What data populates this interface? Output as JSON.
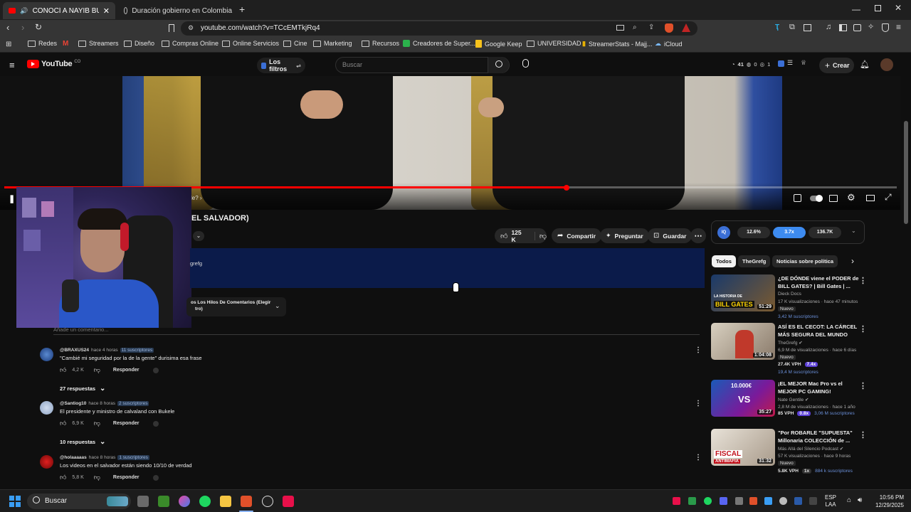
{
  "browser": {
    "tabs": [
      {
        "title": "CONOCÍ A NAYIB BUKELE (P",
        "active": true
      },
      {
        "title": "Duración gobierno en Colombia",
        "active": false
      }
    ],
    "new_tab": "+",
    "url": "youtube.com/watch?v=TCcEMTkjRq4",
    "bookmarks": [
      "Redes",
      "Streamers",
      "Diseño",
      "Compras Online",
      "Online Servicios",
      "Cine",
      "Marketing",
      "Recursos",
      "Creadores de Super...",
      "Google Keep",
      "UNIVERSIDAD",
      "StreamerStats - Majj...",
      "iCloud"
    ]
  },
  "youtube": {
    "logo": "YouTube",
    "logo_country": "CO",
    "filter_button": "Los filtros",
    "search_placeholder": "Buscar",
    "header_stats": {
      "a": "41",
      "b": "0",
      "c": "1"
    },
    "create_button": "Crear"
  },
  "video": {
    "progress_fraction": 0.63,
    "title_visible": "EL SALVADOR)",
    "chapter_fragment": "le?",
    "actions": {
      "likes": "125 K",
      "share": "Compartir",
      "ask": "Preguntar",
      "save": "Guardar"
    },
    "metrics": {
      "a": "12.6%",
      "b": "3.7x",
      "c": "136.7K"
    },
    "channel_fragment": "grefg",
    "sort_fragment": "os Los Hilos De Comentarios (Elegir",
    "sort_fragment2": "tro)",
    "add_comment": "Añade un comentario..."
  },
  "comments": [
    {
      "user": "@BRAXUS24",
      "time": "hace 4 horas",
      "subs": "11 suscriptores",
      "text": "\"Cambié mi seguridad por la de la gente\" durisima esa frase",
      "likes": "4,2 K",
      "reply": "Responder",
      "replies": "27 respuestas",
      "avatar_color": "#2a4d8a"
    },
    {
      "user": "@Santiog10",
      "time": "hace 8 horas",
      "subs": "2 suscriptores",
      "text": "El presidente y ministro de calvaland con Bukele",
      "likes": "6,9 K",
      "reply": "Responder",
      "replies": "10 respuestas",
      "avatar_color": "#9fb3cf"
    },
    {
      "user": "@holaaaaas",
      "time": "hace 8 horas",
      "subs": "1 suscriptores",
      "text": "Los videos en el salvador están siendo 10/10 de verdad",
      "likes": "5,8 K",
      "reply": "Responder",
      "replies": "",
      "avatar_color": "#a01010"
    }
  ],
  "sidebar": {
    "chips": [
      "Todos",
      "TheGrefg",
      "Noticias sobre política"
    ],
    "recommendations": [
      {
        "title": "¿DE DÓNDE viene el PODER de BILL GATES? | Bill Gates | ...",
        "channel": "Dieck Docs",
        "meta": "17 K visualizaciones · hace 47 minutos",
        "badge": "Nuevo",
        "duration": "51:29",
        "thumb_text": "BILL GATES",
        "thumb_text2": "LA HISTORIA DE",
        "stats": [
          {
            "text": "3,42 M suscriptores",
            "color": "#6a8fd8"
          }
        ]
      },
      {
        "title": "ASÍ ES EL CECOT: LA CÁRCEL MÁS SEGURA DEL MUNDO",
        "channel": "TheGrefg",
        "meta": "6,9 M de visualizaciones · hace 6 días",
        "badge": "Nuevo",
        "duration": "1:04:08",
        "thumb_text": "",
        "thumb_text2": "",
        "stats": [
          {
            "text": "27.4K VPH",
            "color": "#e0e0e0"
          },
          {
            "text": "7.4x",
            "color": "#ffffff",
            "bg": "#5b3fd6"
          },
          {
            "text": "19,4 M suscriptores",
            "color": "#6a8fd8"
          }
        ]
      },
      {
        "title": "¡EL MEJOR Mac Pro vs el MEJOR PC GAMING!",
        "channel": "Nate Gentile",
        "meta": "2,8 M de visualizaciones · hace 1 año",
        "badge": "",
        "duration": "35:27",
        "thumb_text": "VS",
        "thumb_text2": "10.000€",
        "stats": [
          {
            "text": "85 VPH",
            "color": "#e0e0e0"
          },
          {
            "text": "0.8x",
            "color": "#ffffff",
            "bg": "#5b3fd6"
          },
          {
            "text": "3,06 M suscriptores",
            "color": "#6a8fd8"
          }
        ]
      },
      {
        "title": "\"Por ROBARLE \"SUPUESTA\" Millonaria COLECCIÓN de ...",
        "channel": "Más Allá del Silencio Podcast",
        "meta": "57 K visualizaciones · hace 9 horas",
        "badge": "Nuevo",
        "duration": "31:32",
        "thumb_text": "FISCAL",
        "thumb_text2": "ANTIMAFIA",
        "stats": [
          {
            "text": "5.8K VPH",
            "color": "#e0e0e0"
          },
          {
            "text": "1x",
            "color": "#e0e0e0"
          },
          {
            "text": "884 k suscriptores",
            "color": "#6a8fd8"
          }
        ]
      }
    ]
  },
  "taskbar": {
    "search": "Buscar",
    "lang_top": "ESP",
    "lang_bottom": "LAA",
    "time": "10:56 PM",
    "date": "12/29/2025"
  }
}
